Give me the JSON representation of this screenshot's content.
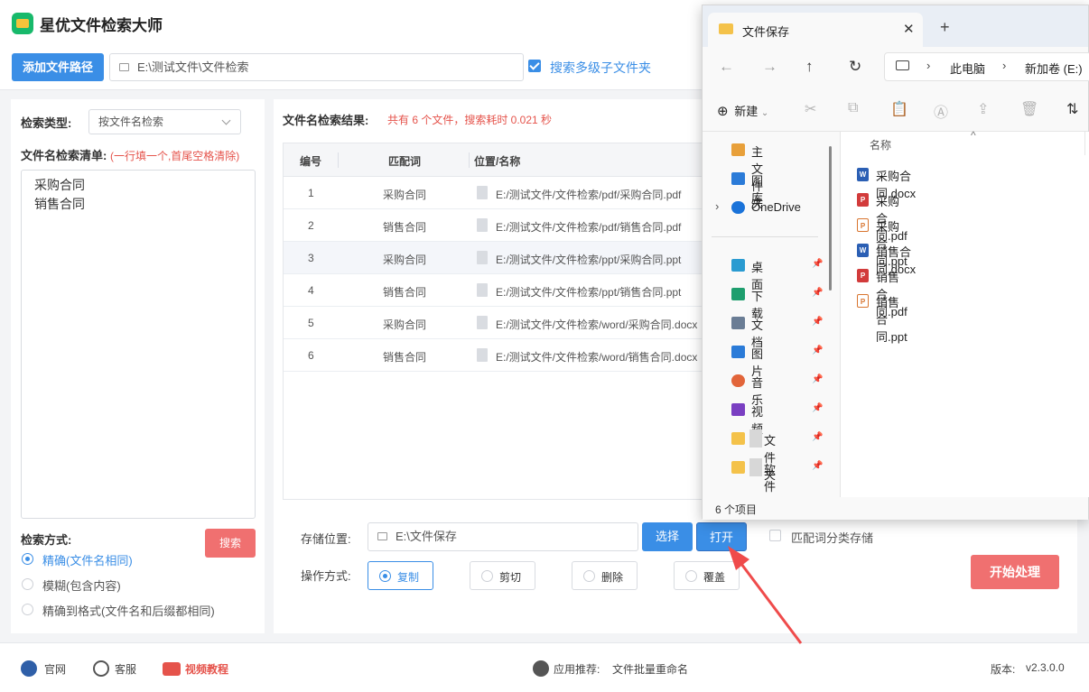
{
  "app": {
    "title": "星优文件检索大师",
    "add_path_button": "添加文件路径",
    "path_value": "E:\\测试文件\\文件检索",
    "subfolder_checkbox": "搜索多级子文件夹"
  },
  "left": {
    "search_type_label": "检索类型:",
    "search_type_value": "按文件名检索",
    "list_label": "文件名检索清单:",
    "list_hint": "(一行填一个,首尾空格清除)",
    "list_items": [
      "采购合同",
      "销售合同"
    ],
    "method_label": "检索方式:",
    "search_button": "搜索",
    "methods": [
      {
        "label": "精确(文件名相同)",
        "selected": true
      },
      {
        "label": "模糊(包含内容)",
        "selected": false
      },
      {
        "label": "精确到格式(文件名和后缀都相同)",
        "selected": false
      }
    ]
  },
  "results": {
    "title": "文件名检索结果:",
    "summary": "共有 6 个文件，搜索耗时 0.021 秒",
    "columns": [
      "编号",
      "匹配词",
      "位置/名称"
    ],
    "rows": [
      {
        "no": "1",
        "word": "采购合同",
        "path": "E:/测试文件/文件检索/pdf/采购合同.pdf"
      },
      {
        "no": "2",
        "word": "销售合同",
        "path": "E:/测试文件/文件检索/pdf/销售合同.pdf"
      },
      {
        "no": "3",
        "word": "采购合同",
        "path": "E:/测试文件/文件检索/ppt/采购合同.ppt"
      },
      {
        "no": "4",
        "word": "销售合同",
        "path": "E:/测试文件/文件检索/ppt/销售合同.ppt"
      },
      {
        "no": "5",
        "word": "采购合同",
        "path": "E:/测试文件/文件检索/word/采购合同.docx"
      },
      {
        "no": "6",
        "word": "销售合同",
        "path": "E:/测试文件/文件检索/word/销售合同.docx"
      }
    ]
  },
  "storage": {
    "label": "存储位置:",
    "value": "E:\\文件保存",
    "select_button": "选择",
    "open_button": "打开",
    "classify_checkbox": "匹配词分类存储",
    "op_label": "操作方式:",
    "ops": [
      {
        "label": "复制",
        "selected": true
      },
      {
        "label": "剪切",
        "selected": false
      },
      {
        "label": "删除",
        "selected": false
      },
      {
        "label": "覆盖",
        "selected": false
      }
    ],
    "start_button": "开始处理"
  },
  "statusbar": {
    "website": "官网",
    "support": "客服",
    "video": "视频教程",
    "recommend_label": "应用推荐:",
    "recommend_value": "文件批量重命名",
    "version_label": "版本:",
    "version_value": "v2.3.0.0"
  },
  "explorer": {
    "tab_title": "文件保存",
    "breadcrumb": [
      "此电脑",
      "新加卷 (E:)"
    ],
    "new_button": "新建",
    "sidebar": [
      {
        "label": "主文件夹",
        "icon": "home-icon"
      },
      {
        "label": "图库",
        "icon": "gallery-icon"
      },
      {
        "label": "OneDrive",
        "icon": "cloud-icon"
      },
      {
        "label": "桌面",
        "icon": "desktop-icon"
      },
      {
        "label": "下载",
        "icon": "download-icon"
      },
      {
        "label": "文档",
        "icon": "document-icon"
      },
      {
        "label": "图片",
        "icon": "picture-icon"
      },
      {
        "label": "音乐",
        "icon": "music-icon"
      },
      {
        "label": "视频",
        "icon": "video-icon"
      },
      {
        "label": "文件夹",
        "icon": "folder-icon"
      },
      {
        "label": "软件",
        "icon": "folder-icon"
      }
    ],
    "column_name": "名称",
    "files": [
      {
        "name": "采购合同.docx",
        "type": "docx"
      },
      {
        "name": "采购合同.pdf",
        "type": "pdf"
      },
      {
        "name": "采购合同.ppt",
        "type": "ppt"
      },
      {
        "name": "销售合同.docx",
        "type": "docx"
      },
      {
        "name": "销售合同.pdf",
        "type": "pdf"
      },
      {
        "name": "销售合同.ppt",
        "type": "ppt"
      }
    ],
    "status": "6 个项目"
  },
  "colors": {
    "accent": "#3a8ee6",
    "danger": "#f07070",
    "arrow": "#ef4b4b"
  }
}
